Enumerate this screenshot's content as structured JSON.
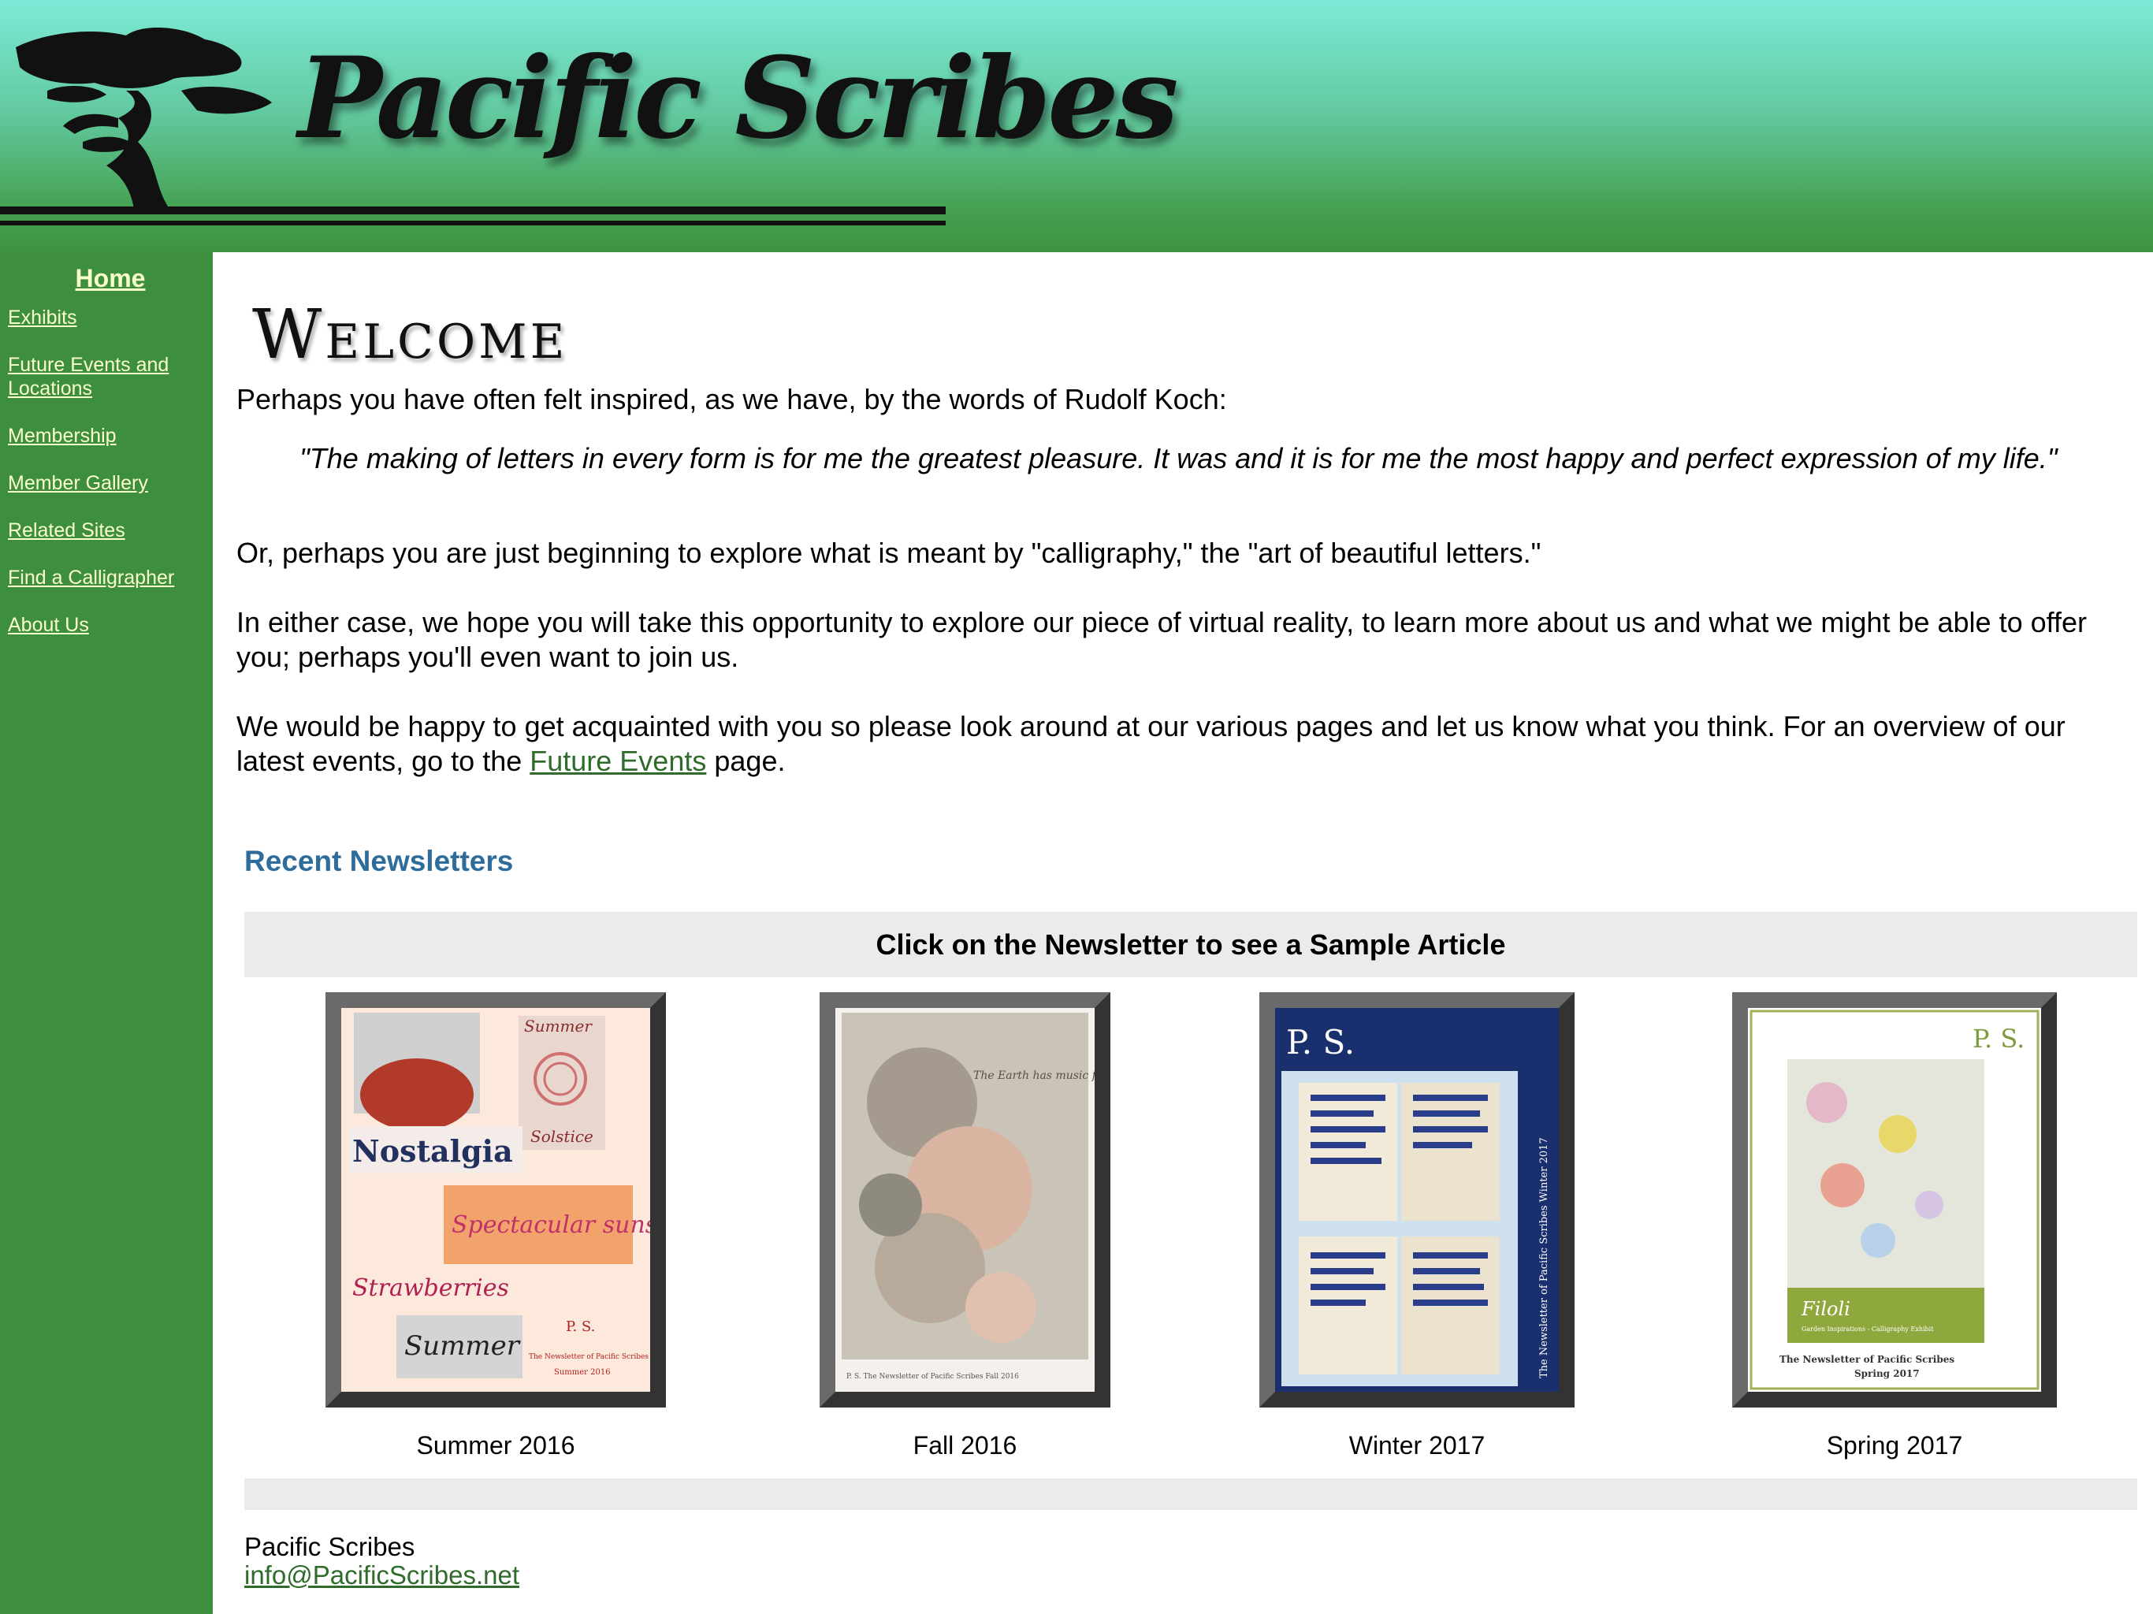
{
  "header": {
    "site_title": "Pacific Scribes",
    "logo_icon": "cypress-tree-icon"
  },
  "sidebar": {
    "home_label": "Home",
    "items": [
      {
        "label": "Exhibits"
      },
      {
        "label": "Future Events and Locations"
      },
      {
        "label": "Membership"
      },
      {
        "label": "Member Gallery"
      },
      {
        "label": "Related Sites"
      },
      {
        "label": "Find a Calligrapher"
      },
      {
        "label": "About Us"
      }
    ]
  },
  "main": {
    "welcome_heading": "Welcome",
    "intro": "Perhaps you have often felt inspired, as we have, by the words of Rudolf Koch:",
    "quote": "\"The making of letters in every form is for me the greatest pleasure. It was and it is for me the most happy and perfect expression of my life.\"",
    "para2": "Or, perhaps you are just beginning to explore what is meant by \"calligraphy,\" the \"art of beautiful letters.\"",
    "para3": "In either case, we hope you will take this opportunity to explore our piece of virtual reality, to learn more about us and what we might be able to offer you; perhaps you'll even want to join us.",
    "para4_before": "We would be happy to get acquainted with you so please look around at our various pages and let us know what you think. For an overview of our latest events, go to the",
    "para4_link": "Future Events",
    "para4_after": "page."
  },
  "newsletters": {
    "heading": "Recent Newsletters",
    "instruction": "Click on the Newsletter to see a Sample Article",
    "items": [
      {
        "label": "Summer 2016"
      },
      {
        "label": "Fall 2016"
      },
      {
        "label": "Winter 2017"
      },
      {
        "label": "Spring 2017"
      }
    ],
    "cover_texts": {
      "summer_words": [
        "Summer",
        "Solstice",
        "Nostalgia",
        "Spectacular sunsets",
        "Strawberries",
        "Summer"
      ],
      "summer_footer": [
        "P. S.",
        "The Newsletter of Pacific Scribes",
        "Summer 2016"
      ],
      "fall_script": "The Earth has music for those who listen.",
      "fall_footer": "P. S. The Newsletter of Pacific Scribes Fall 2016",
      "winter_ps": "P. S.",
      "winter_side": "The Newsletter of Pacific Scribes Winter 2017",
      "spring_ps": "P. S.",
      "spring_filoli": "Filoli",
      "spring_sub": "Garden Inspirations - Calligraphy Exhibit",
      "spring_footer": [
        "The Newsletter of Pacific Scribes",
        "Spring 2017"
      ]
    }
  },
  "footer": {
    "name": "Pacific Scribes",
    "email": "info@PacificScribes.net"
  },
  "colors": {
    "sidebar_bg": "#3e8e3f",
    "nav_link": "#fbffc8",
    "heading_blue": "#2e6c9c",
    "link_green": "#2f6b2a"
  }
}
